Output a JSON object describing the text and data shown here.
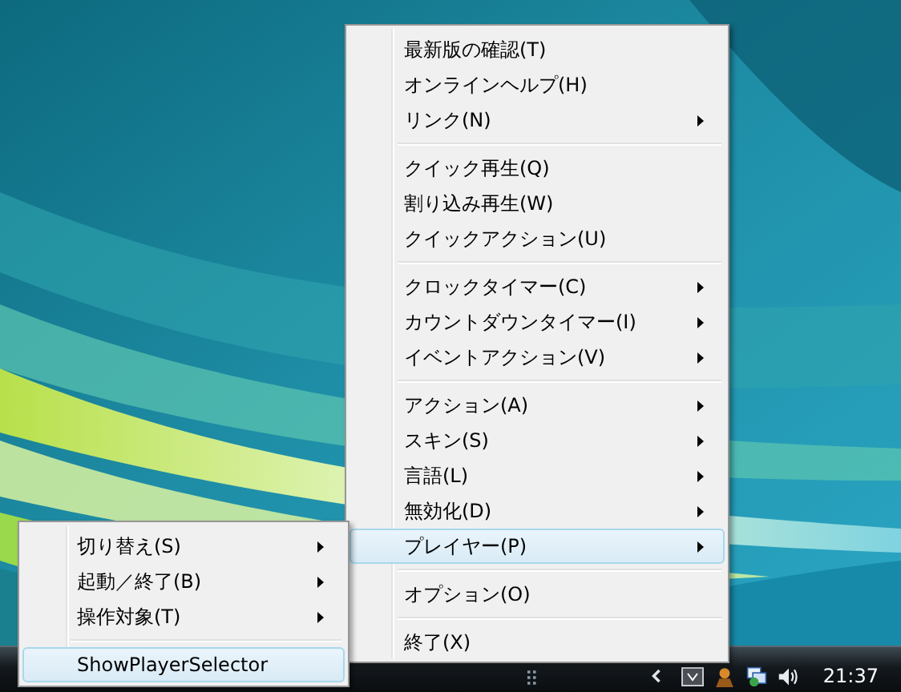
{
  "menu": {
    "items": [
      {
        "kind": "item",
        "label": "最新版の確認(T)",
        "submenu": false,
        "selected": false
      },
      {
        "kind": "item",
        "label": "オンラインヘルプ(H)",
        "submenu": false,
        "selected": false
      },
      {
        "kind": "item",
        "label": "リンク(N)",
        "submenu": true,
        "selected": false
      },
      {
        "kind": "separator"
      },
      {
        "kind": "item",
        "label": "クイック再生(Q)",
        "submenu": false,
        "selected": false
      },
      {
        "kind": "item",
        "label": "割り込み再生(W)",
        "submenu": false,
        "selected": false
      },
      {
        "kind": "item",
        "label": "クイックアクション(U)",
        "submenu": false,
        "selected": false
      },
      {
        "kind": "separator"
      },
      {
        "kind": "item",
        "label": "クロックタイマー(C)",
        "submenu": true,
        "selected": false
      },
      {
        "kind": "item",
        "label": "カウントダウンタイマー(I)",
        "submenu": true,
        "selected": false
      },
      {
        "kind": "item",
        "label": "イベントアクション(V)",
        "submenu": true,
        "selected": false
      },
      {
        "kind": "separator"
      },
      {
        "kind": "item",
        "label": "アクション(A)",
        "submenu": true,
        "selected": false
      },
      {
        "kind": "item",
        "label": "スキン(S)",
        "submenu": true,
        "selected": false
      },
      {
        "kind": "item",
        "label": "言語(L)",
        "submenu": true,
        "selected": false
      },
      {
        "kind": "item",
        "label": "無効化(D)",
        "submenu": true,
        "selected": false
      },
      {
        "kind": "item",
        "label": "プレイヤー(P)",
        "submenu": true,
        "selected": true
      },
      {
        "kind": "separator"
      },
      {
        "kind": "item",
        "label": "オプション(O)",
        "submenu": false,
        "selected": false
      },
      {
        "kind": "separator"
      },
      {
        "kind": "item",
        "label": "終了(X)",
        "submenu": false,
        "selected": false
      }
    ]
  },
  "submenu": {
    "items": [
      {
        "kind": "item",
        "label": "切り替え(S)",
        "submenu": true,
        "selected": false
      },
      {
        "kind": "item",
        "label": "起動／終了(B)",
        "submenu": true,
        "selected": false
      },
      {
        "kind": "item",
        "label": "操作対象(T)",
        "submenu": true,
        "selected": false
      },
      {
        "kind": "separator"
      },
      {
        "kind": "item",
        "label": "ShowPlayerSelector",
        "submenu": false,
        "selected": true
      }
    ]
  },
  "taskbar": {
    "clock": "21:37"
  }
}
